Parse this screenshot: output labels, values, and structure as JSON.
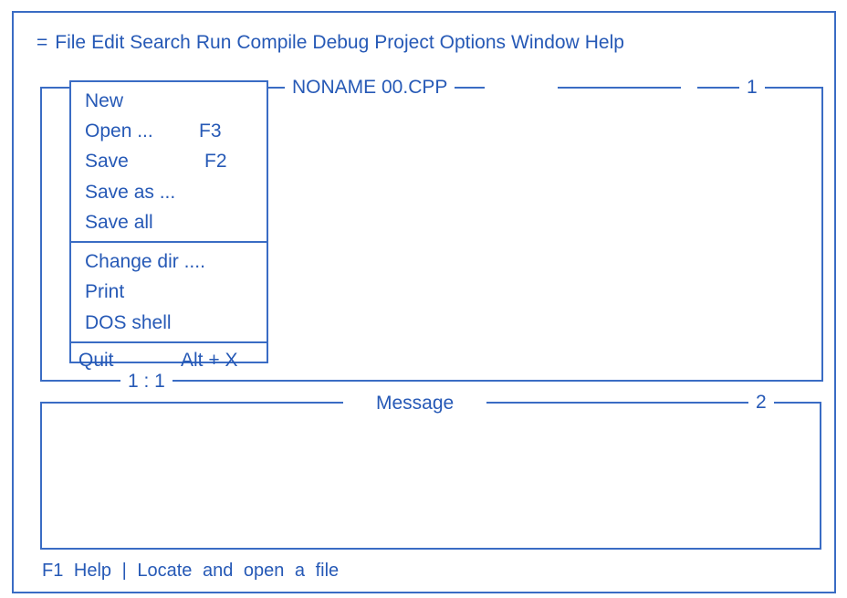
{
  "menubar": {
    "system": "=",
    "items": [
      "File",
      "Edit",
      "Search",
      "Run",
      "Compile",
      "Debug",
      "Project",
      "Options",
      "Window",
      "Help"
    ]
  },
  "editor": {
    "title": "NONAME 00.CPP",
    "number": "1",
    "position": "1 : 1"
  },
  "file_menu": {
    "groups": [
      [
        {
          "label": "New",
          "key": ""
        },
        {
          "label": "Open ...",
          "key": "F3"
        },
        {
          "label": "Save",
          "key": "F2"
        },
        {
          "label": "Save as ...",
          "key": ""
        },
        {
          "label": "Save all",
          "key": ""
        }
      ],
      [
        {
          "label": "Change dir ....",
          "key": ""
        },
        {
          "label": "Print",
          "key": ""
        },
        {
          "label": "DOS shell",
          "key": ""
        }
      ],
      [
        {
          "label": "Quit",
          "key": "Alt + X"
        }
      ]
    ]
  },
  "message": {
    "title": "Message",
    "number": "2"
  },
  "status": {
    "text": "F1 Help |  Locate and open a file"
  }
}
